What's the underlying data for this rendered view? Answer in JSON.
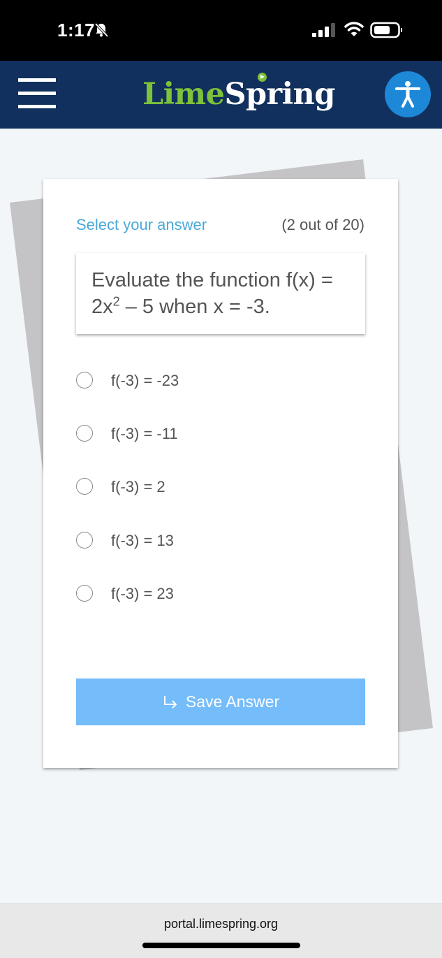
{
  "status_bar": {
    "time": "1:17",
    "icons": [
      "bell-slash-icon",
      "signal-icon",
      "wifi-icon",
      "battery-icon"
    ]
  },
  "header": {
    "logo_part1": "Lime",
    "logo_part2": "Spring",
    "menu_icon": "hamburger-menu-icon",
    "accessibility_icon": "accessibility-icon",
    "colors": {
      "background": "#12305d",
      "logo_green": "#7dc23a",
      "a11y_blue": "#1e88d8"
    }
  },
  "quiz": {
    "instruction": "Select your answer",
    "progress": "(2 out of 20)",
    "question_line1": "Evaluate the function f(x) =",
    "question_line2_base": "2x",
    "question_line2_exp": "2",
    "question_line2_rest": " – 5 when x = -3.",
    "options": [
      {
        "label": "f(-3) = -23",
        "selected": false
      },
      {
        "label": "f(-3) = -11",
        "selected": false
      },
      {
        "label": "f(-3) = 2",
        "selected": false
      },
      {
        "label": "f(-3) = 13",
        "selected": false
      },
      {
        "label": "f(-3) = 23",
        "selected": false
      }
    ],
    "save_label": "Save Answer",
    "colors": {
      "instruction": "#49a8d8",
      "save_button": "#74bcfa"
    }
  },
  "browser": {
    "url": "portal.limespring.org"
  }
}
